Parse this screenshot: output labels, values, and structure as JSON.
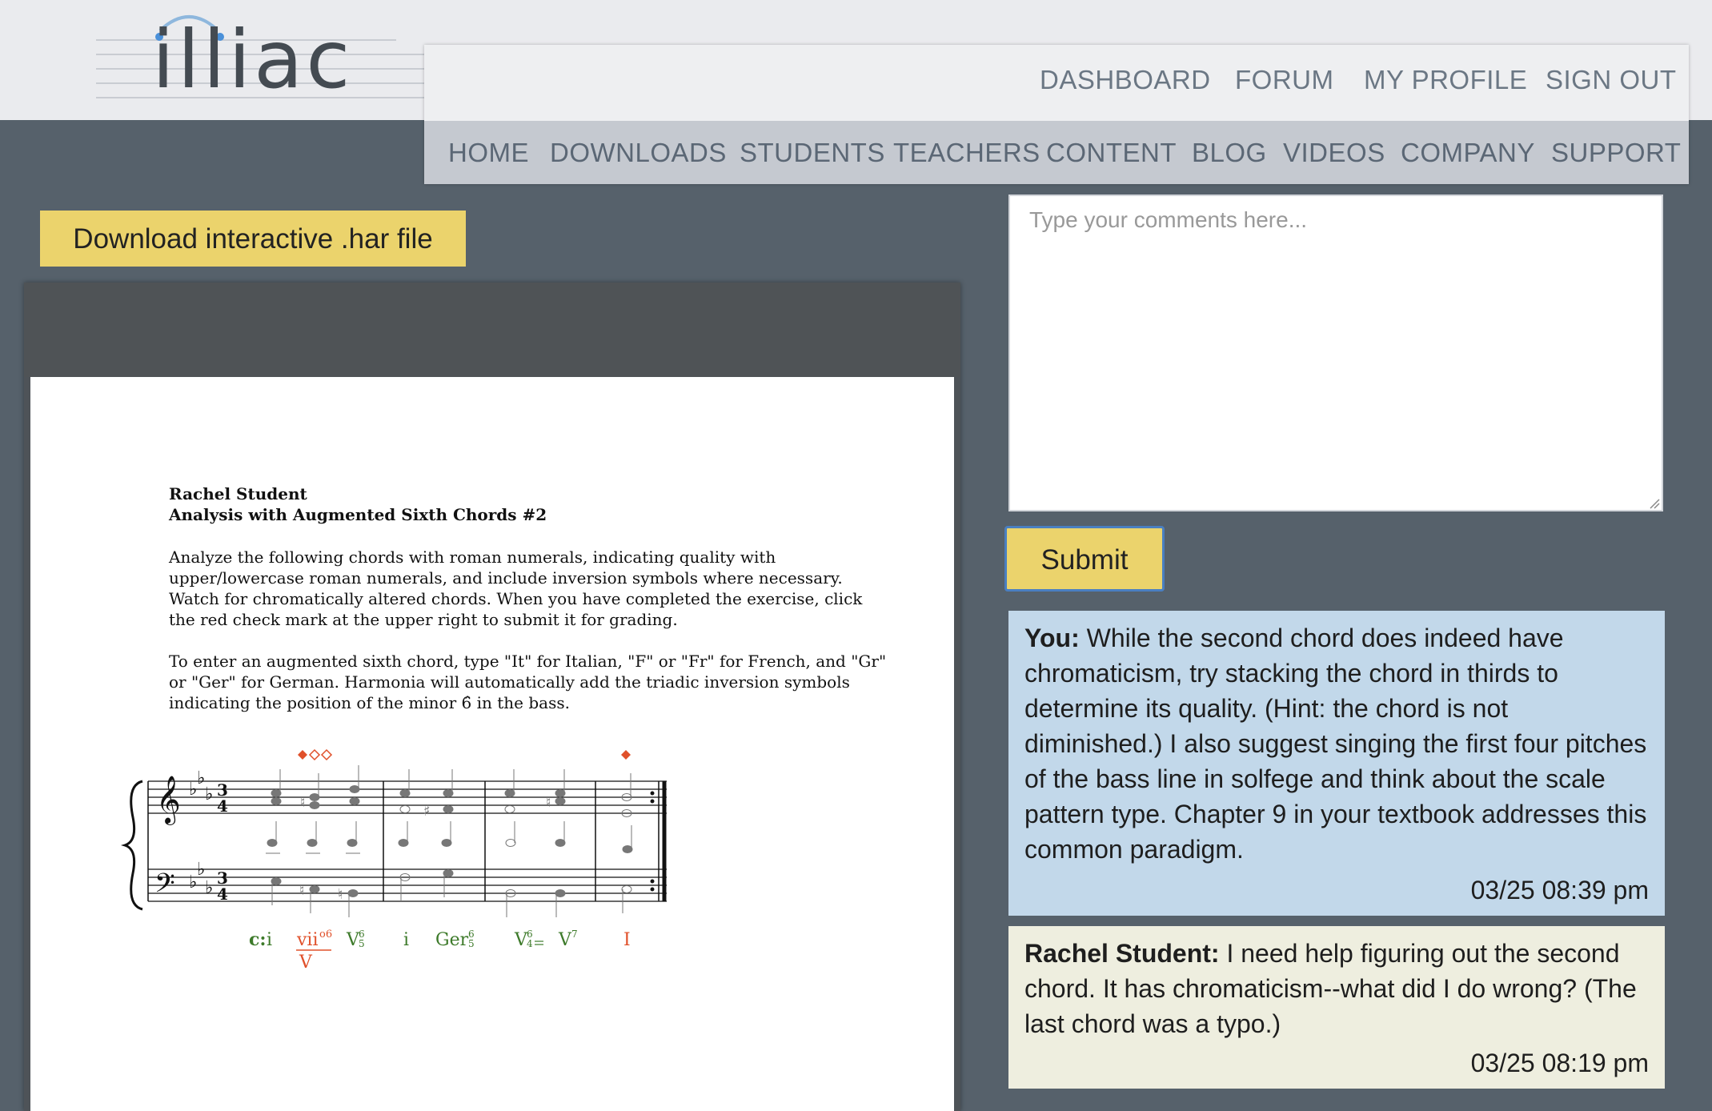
{
  "logo": {
    "text": "illiac"
  },
  "nav": {
    "top": [
      "DASHBOARD",
      "FORUM",
      "MY PROFILE",
      "SIGN OUT"
    ],
    "main": [
      "HOME",
      "DOWNLOADS",
      "STUDENTS",
      "TEACHERS",
      "CONTENT",
      "BLOG",
      "VIDEOS",
      "COMPANY",
      "SUPPORT"
    ]
  },
  "download_button": "Download interactive .har file",
  "document": {
    "student_name": "Rachel Student",
    "title": "Analysis with Augmented Sixth Chords #2",
    "paragraph1": "Analyze the following chords with roman numerals, indicating quality with upper/lowercase roman numerals, and include inversion symbols where necessary. Watch for chromatically altered chords. When you have completed the exercise, click the red check mark at the upper right to submit it for grading.",
    "paragraph2": "To enter an augmented sixth chord, type \"It\" for Italian, \"F\" or \"Fr\" for French, and \"Gr\" or \"Ger\" for German. Harmonia will automatically add the triadic inversion symbols indicating the position of the minor 6̂ in the bass.",
    "analysis": {
      "key": "c:",
      "chord1": "i",
      "chord2_numeral": "vii",
      "chord2_figure": "o6",
      "chord2_applied": "V",
      "chord3": "V",
      "chord3_fig_top": "6",
      "chord3_fig_bottom": "5",
      "chord4": "i",
      "chord5": "Ger",
      "chord5_fig_top": "6",
      "chord5_fig_bottom": "5",
      "chord6": "V",
      "chord6_fig_top": "6",
      "chord6_fig_bottom": "4",
      "chord7": "V",
      "chord7_fig": "7",
      "chord8": "I"
    },
    "colors": {
      "correct": "#3d7a2a",
      "incorrect": "#e0502a"
    }
  },
  "comment_form": {
    "placeholder": "Type your comments here...",
    "submit_label": "Submit"
  },
  "messages": [
    {
      "author": "You:",
      "text": "While the second chord does indeed have chromaticism, try stacking the chord in thirds to determine its quality. (Hint: the chord is not diminished.) I also suggest singing the first four pitches of the bass line in solfege and think about the scale pattern type. Chapter 9 in your textbook addresses this common paradigm.",
      "time": "03/25 08:39 pm"
    },
    {
      "author": "Rachel Student:",
      "text": "I need help figuring out the second chord. It has chromaticism--what did I do wrong? (The last chord was a typo.)",
      "time": "03/25 08:19 pm"
    }
  ]
}
